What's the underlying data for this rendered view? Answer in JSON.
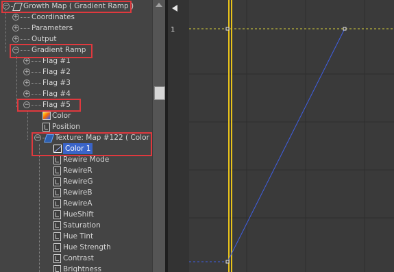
{
  "tree": {
    "rows": [
      {
        "label": "Growth Map  ( Gradient Ramp )",
        "indent": 0,
        "toggle": "minus",
        "icon": "map-icon"
      },
      {
        "label": "Coordinates",
        "indent": 1,
        "toggle": "plus",
        "icon": ""
      },
      {
        "label": "Parameters",
        "indent": 1,
        "toggle": "plus",
        "icon": ""
      },
      {
        "label": "Output",
        "indent": 1,
        "toggle": "plus",
        "icon": ""
      },
      {
        "label": "Gradient Ramp",
        "indent": 1,
        "toggle": "minus",
        "icon": ""
      },
      {
        "label": "Flag #1",
        "indent": 2,
        "toggle": "plus",
        "icon": ""
      },
      {
        "label": "Flag #2",
        "indent": 2,
        "toggle": "plus",
        "icon": ""
      },
      {
        "label": "Flag #3",
        "indent": 2,
        "toggle": "plus",
        "icon": ""
      },
      {
        "label": "Flag #4",
        "indent": 2,
        "toggle": "plus",
        "icon": ""
      },
      {
        "label": "Flag #5",
        "indent": 2,
        "toggle": "minus",
        "icon": ""
      },
      {
        "label": "Color",
        "indent": 3,
        "toggle": "",
        "icon": "color-swatch-icon"
      },
      {
        "label": "Position",
        "indent": 3,
        "toggle": "",
        "icon": "track-icon"
      },
      {
        "label": "Texture: Map #122  ( Color C",
        "indent": 3,
        "toggle": "minus",
        "icon": "map-icon-blue"
      },
      {
        "label": "Color 1",
        "indent": 4,
        "toggle": "",
        "icon": "color-curve-icon",
        "selected": true
      },
      {
        "label": "Rewire Mode",
        "indent": 4,
        "toggle": "",
        "icon": "track-icon"
      },
      {
        "label": "RewireR",
        "indent": 4,
        "toggle": "",
        "icon": "track-icon"
      },
      {
        "label": "RewireG",
        "indent": 4,
        "toggle": "",
        "icon": "track-icon"
      },
      {
        "label": "RewireB",
        "indent": 4,
        "toggle": "",
        "icon": "track-icon"
      },
      {
        "label": "RewireA",
        "indent": 4,
        "toggle": "",
        "icon": "track-icon"
      },
      {
        "label": "HueShift",
        "indent": 4,
        "toggle": "",
        "icon": "track-icon"
      },
      {
        "label": "Saturation",
        "indent": 4,
        "toggle": "",
        "icon": "track-icon"
      },
      {
        "label": "Hue Tint",
        "indent": 4,
        "toggle": "",
        "icon": "track-icon"
      },
      {
        "label": "Hue Strength",
        "indent": 4,
        "toggle": "",
        "icon": "track-icon"
      },
      {
        "label": "Contrast",
        "indent": 4,
        "toggle": "",
        "icon": "track-icon"
      },
      {
        "label": "Brightness",
        "indent": 4,
        "toggle": "",
        "icon": "track-icon"
      }
    ]
  },
  "graph": {
    "y_tick_label": "1",
    "colors": {
      "curve": "#3f5fe6",
      "time_marker": "#e8c21a",
      "reference_line": "#d9d23a",
      "highlight": "#e0393e"
    }
  }
}
